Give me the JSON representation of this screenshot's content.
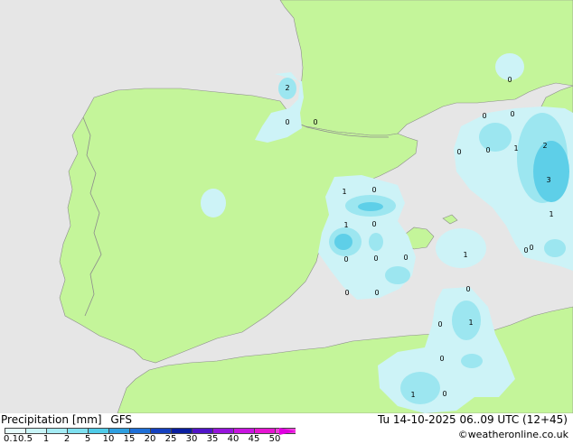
{
  "title_left": "Precipitation [mm]",
  "model": "GFS",
  "valid_time": "Tu 14-10-2025 06..09 UTC (12+45)",
  "credit": "©weatheronline.co.uk",
  "colors": {
    "sea": "#e6e6e6",
    "land": "#c4f59a",
    "border": "#8c8c8c",
    "precip_light": "#cdf3f7",
    "precip_mid": "#9ce6f0",
    "precip_heavy": "#5ecfe8"
  },
  "scale": {
    "ticks": [
      "0.1",
      "0.5",
      "1",
      "2",
      "5",
      "10",
      "15",
      "20",
      "25",
      "30",
      "35",
      "40",
      "45",
      "50"
    ],
    "colors": [
      "#e6fcfc",
      "#c8f5f8",
      "#a5ecf5",
      "#7ee0f0",
      "#4fcbe8",
      "#2e9fe0",
      "#1e6fd8",
      "#1440c0",
      "#0a1ea0",
      "#5014c8",
      "#9614dc",
      "#c814e0",
      "#e614d2",
      "#f03cdc"
    ]
  },
  "map_labels": [
    {
      "text": "2"
    },
    {
      "text": "0"
    },
    {
      "text": "0"
    },
    {
      "text": "0"
    },
    {
      "text": "0"
    },
    {
      "text": "0"
    },
    {
      "text": "0"
    },
    {
      "text": "1"
    },
    {
      "text": "2"
    },
    {
      "text": "0"
    },
    {
      "text": "3"
    },
    {
      "text": "1"
    },
    {
      "text": "1"
    },
    {
      "text": "0"
    },
    {
      "text": "1"
    },
    {
      "text": "0"
    },
    {
      "text": "0"
    },
    {
      "text": "0"
    },
    {
      "text": "0"
    },
    {
      "text": "0"
    },
    {
      "text": "0"
    },
    {
      "text": "1"
    },
    {
      "text": "0"
    },
    {
      "text": "0"
    },
    {
      "text": "0"
    },
    {
      "text": "1"
    },
    {
      "text": "0"
    },
    {
      "text": "0"
    },
    {
      "text": "1"
    },
    {
      "text": "0"
    }
  ]
}
